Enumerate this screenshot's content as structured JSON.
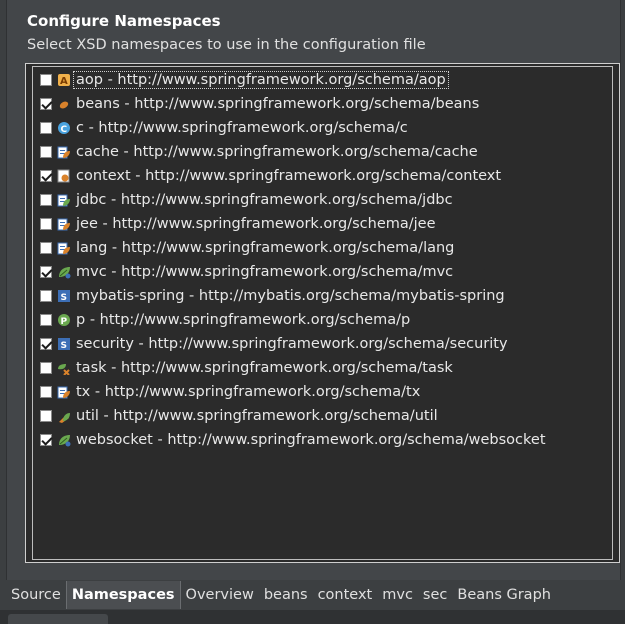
{
  "header": {
    "title": "Configure Namespaces",
    "subtitle": "Select XSD namespaces to use in the configuration file"
  },
  "namespaces": [
    {
      "label": "aop - http://www.springframework.org/schema/aop",
      "checked": false,
      "icon": "aop-icon"
    },
    {
      "label": "beans - http://www.springframework.org/schema/beans",
      "checked": true,
      "icon": "beans-icon"
    },
    {
      "label": "c - http://www.springframework.org/schema/c",
      "checked": false,
      "icon": "c-icon"
    },
    {
      "label": "cache - http://www.springframework.org/schema/cache",
      "checked": false,
      "icon": "cache-icon"
    },
    {
      "label": "context - http://www.springframework.org/schema/context",
      "checked": true,
      "icon": "context-icon"
    },
    {
      "label": "jdbc - http://www.springframework.org/schema/jdbc",
      "checked": false,
      "icon": "jdbc-icon"
    },
    {
      "label": "jee - http://www.springframework.org/schema/jee",
      "checked": false,
      "icon": "jee-icon"
    },
    {
      "label": "lang - http://www.springframework.org/schema/lang",
      "checked": false,
      "icon": "lang-icon"
    },
    {
      "label": "mvc - http://www.springframework.org/schema/mvc",
      "checked": true,
      "icon": "mvc-icon"
    },
    {
      "label": "mybatis-spring - http://mybatis.org/schema/mybatis-spring",
      "checked": false,
      "icon": "mybatis-spring-icon"
    },
    {
      "label": "p - http://www.springframework.org/schema/p",
      "checked": false,
      "icon": "p-icon"
    },
    {
      "label": "security - http://www.springframework.org/schema/security",
      "checked": true,
      "icon": "security-icon"
    },
    {
      "label": "task - http://www.springframework.org/schema/task",
      "checked": false,
      "icon": "task-icon"
    },
    {
      "label": "tx - http://www.springframework.org/schema/tx",
      "checked": false,
      "icon": "tx-icon"
    },
    {
      "label": "util - http://www.springframework.org/schema/util",
      "checked": false,
      "icon": "util-icon"
    },
    {
      "label": "websocket - http://www.springframework.org/schema/websocket",
      "checked": true,
      "icon": "websocket-icon"
    }
  ],
  "tabs": [
    {
      "label": "Source",
      "active": false
    },
    {
      "label": "Namespaces",
      "active": true
    },
    {
      "label": "Overview",
      "active": false
    },
    {
      "label": "beans",
      "active": false
    },
    {
      "label": "context",
      "active": false
    },
    {
      "label": "mvc",
      "active": false
    },
    {
      "label": "sec",
      "active": false
    },
    {
      "label": "Beans Graph",
      "active": false
    }
  ],
  "colors": {
    "background": "#3c3f41",
    "list_background": "#2b2b2b",
    "text": "#e8e8e8",
    "leaf_green": "#6aa84f",
    "bean_orange": "#d9822b",
    "doc_blue": "#3d6fb6"
  }
}
